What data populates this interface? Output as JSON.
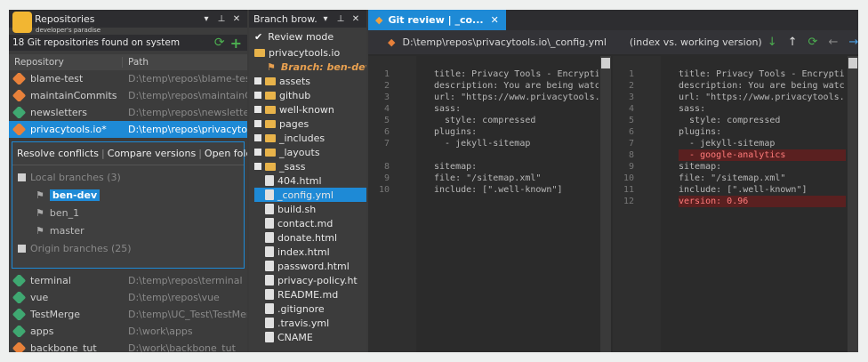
{
  "logo": {
    "caption": "developer's paradise"
  },
  "repos_panel": {
    "title": "Repositories",
    "count_text": "18 Git repositories found on system",
    "columns": [
      "Repository",
      "Path"
    ],
    "rows_top": [
      {
        "name": "blame-test",
        "path": "D:\\temp\\repos\\blame-test",
        "color": "orange"
      },
      {
        "name": "maintainCommits",
        "path": "D:\\temp\\repos\\maintainCo",
        "color": "orange"
      },
      {
        "name": "newsletters",
        "path": "D:\\temp\\repos\\newsletters",
        "color": "green"
      },
      {
        "name": "privacytools.io*",
        "path": "D:\\temp\\repos\\privacytool",
        "color": "orange",
        "selected": true
      }
    ],
    "actions": [
      "Resolve conflicts",
      "Compare versions",
      "Open folder"
    ],
    "local_branches_label": "Local branches (3)",
    "local_branches": [
      "ben-dev",
      "ben_1",
      "master"
    ],
    "origin_branches_label": "Origin branches (25)",
    "rows_bottom": [
      {
        "name": "terminal",
        "path": "D:\\temp\\repos\\terminal",
        "color": "green"
      },
      {
        "name": "vue",
        "path": "D:\\temp\\repos\\vue",
        "color": "green"
      },
      {
        "name": "TestMerge",
        "path": "D:\\temp\\UC_Test\\TestMerg",
        "color": "green"
      },
      {
        "name": "apps",
        "path": "D:\\work\\apps",
        "color": "green"
      },
      {
        "name": "backbone_tut",
        "path": "D:\\work\\backbone_tut",
        "color": "orange"
      }
    ]
  },
  "branch_panel": {
    "title": "Branch brow...",
    "review_mode": "Review mode",
    "root": "privacytools.io",
    "branch": "Branch: ben-dev",
    "folders": [
      "assets",
      "github",
      "well-known",
      "pages",
      "_includes",
      "_layouts",
      "_sass"
    ],
    "files": [
      "404.html",
      "_config.yml",
      "build.sh",
      "contact.md",
      "donate.html",
      "index.html",
      "password.html",
      "privacy-policy.ht",
      "README.md",
      ".gitignore",
      ".travis.yml",
      "CNAME"
    ]
  },
  "review": {
    "tab": "Git review | _co...",
    "path": "D:\\temp\\repos\\privacytools.io\\_config.yml",
    "mode": "(index vs. working version)",
    "left_lines": [
      {
        "n": "1",
        "text": "title: Privacy Tools - Encrypti"
      },
      {
        "n": "2",
        "text": "description: You are being watc"
      },
      {
        "n": "3",
        "text": "url: \"https://www.privacytools."
      },
      {
        "n": "4",
        "text": "sass:"
      },
      {
        "n": "5",
        "text": "  style: compressed"
      },
      {
        "n": "6",
        "text": "plugins:"
      },
      {
        "n": "7",
        "text": "  - jekyll-sitemap"
      },
      {
        "n": "",
        "text": ""
      },
      {
        "n": "8",
        "text": "sitemap:"
      },
      {
        "n": "9",
        "text": "file: \"/sitemap.xml\""
      },
      {
        "n": "10",
        "text": "include: [\".well-known\"]"
      }
    ],
    "right_lines": [
      {
        "n": "1",
        "text": "title: Privacy Tools - Encrypti"
      },
      {
        "n": "2",
        "text": "description: You are being watc"
      },
      {
        "n": "3",
        "text": "url: \"https://www.privacytools."
      },
      {
        "n": "4",
        "text": "sass:"
      },
      {
        "n": "5",
        "text": "  style: compressed"
      },
      {
        "n": "6",
        "text": "plugins:"
      },
      {
        "n": "7",
        "text": "  - jekyll-sitemap"
      },
      {
        "n": "8",
        "text": "  - google-analytics",
        "added": true
      },
      {
        "n": "9",
        "text": "sitemap:"
      },
      {
        "n": "10",
        "text": "file: \"/sitemap.xml\""
      },
      {
        "n": "11",
        "text": "include: [\".well-known\"]"
      },
      {
        "n": "12",
        "text": "version: 0.96",
        "added": true
      }
    ]
  }
}
